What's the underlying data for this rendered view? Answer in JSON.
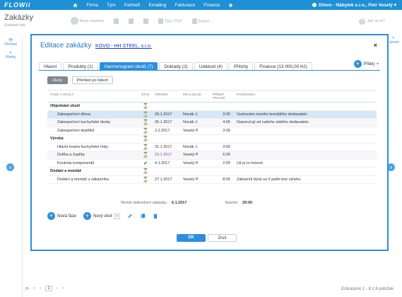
{
  "app": {
    "logo": "FLOWii"
  },
  "nav": {
    "items": [
      "Firma",
      "Tým",
      "Partneři",
      "Emailing",
      "Fakturace",
      "Finance"
    ]
  },
  "user": {
    "label": "Dřevo - Nábytek s.r.o., Petr Veselý"
  },
  "page": {
    "title": "Zakázky",
    "subtitle": "Zobrazit vše"
  },
  "toolbar": {
    "new": "Nová zakázka",
    "print": "Tisk / PDF",
    "export": "Export..."
  },
  "help": "Jak na to?",
  "leftside": {
    "overview": "Přehled",
    "filter": "Hledej"
  },
  "rightside": {
    "edit": "Upravit"
  },
  "footer": {
    "page": "1",
    "count": "Zobrazeno 1 - 8 z 8 položek"
  },
  "modal": {
    "title": "Editace zakázky",
    "link": "KOVO - HH STEEL, s.r.o.",
    "close": "×",
    "tabs": [
      "Hlavní",
      "Produkty (1)",
      "Harmonogram úkolů (7)",
      "Doklady (2)",
      "Události (4)",
      "Přílohy",
      "Finance (13 000,00 Kč)"
    ],
    "add_label": "Přidej",
    "subtabs": [
      "Úkoly",
      "Přehled po lidech"
    ],
    "headers": {
      "name": "FÁZE A ÚKOLY",
      "state": "STAV",
      "term": "TERMÍN",
      "real": "REALIZUJE",
      "time1": "PŘEDP.",
      "time2": "TRVÁNÍ",
      "note": "POZNÁMKA"
    },
    "rows": [
      {
        "type": "group",
        "name": "Objednání zboží",
        "state": "hg",
        "term": "",
        "real": "",
        "time": "",
        "note": ""
      },
      {
        "type": "task",
        "name": "Zabezpečení dřeva",
        "state": "hg",
        "term": "29.1.2017",
        "real": "Novák J.",
        "time": "3:00",
        "note": "Vyzkoušet nového levnějšího dodavatele."
      },
      {
        "type": "task",
        "name": "Zabezpečení kuchyňské desky",
        "state": "hg",
        "term": "30.1.2017",
        "real": "Novák J.",
        "time": "4:00",
        "note": "Doporučují od našeho stálého dodavatele."
      },
      {
        "type": "task",
        "name": "Zabezpečení doplňků",
        "state": "hg",
        "term": "2.2.2017",
        "real": "Veselý P.",
        "time": "3:00",
        "note": ""
      },
      {
        "type": "group",
        "name": "Výroba",
        "state": "hg",
        "term": "",
        "real": "",
        "time": "",
        "note": ""
      },
      {
        "type": "task",
        "name": "Hlavní kostra kuchyňské linky",
        "state": "hg",
        "term": "31.1.2017",
        "real": "Novák J.",
        "time": "3:00",
        "note": ""
      },
      {
        "type": "task",
        "name": "Dvířka a šuplíky",
        "state": "hg",
        "term": "23.1.2017",
        "real": "Veselý P.",
        "time": "6:00",
        "note": ""
      },
      {
        "type": "task",
        "name": "Kontrola komponentů",
        "state": "ok",
        "term": "4.1.2017",
        "real": "Veselý P.",
        "time": "2:00",
        "note": "Už je to hotové."
      },
      {
        "type": "group",
        "name": "Dodání a montáž",
        "state": "hg",
        "term": "",
        "real": "",
        "time": "",
        "note": ""
      },
      {
        "type": "task",
        "name": "Dodání a montáž u zákazníka",
        "state": "hg",
        "term": "27.1.2017",
        "real": "Veselý P.",
        "time": "8:00",
        "note": "Zákazník bývá na 5 patře bez výtahu."
      }
    ],
    "summary": {
      "label": "Termín dokončení zakázky:",
      "date": "6.1.2017",
      "sum_label": "Součet:",
      "sum": "29:00"
    },
    "actions": {
      "new_phase": "Nová fáze",
      "new_task": "Nový úkol"
    },
    "buttons": {
      "ok": "OK",
      "cancel": "Zruš"
    }
  },
  "colors": {
    "accent": "#2d8fdd",
    "topbar": "#1f8fd6",
    "selected_row": "#d5e8f8",
    "late_date": "#8b3fb8",
    "done": "#2fa84f"
  }
}
